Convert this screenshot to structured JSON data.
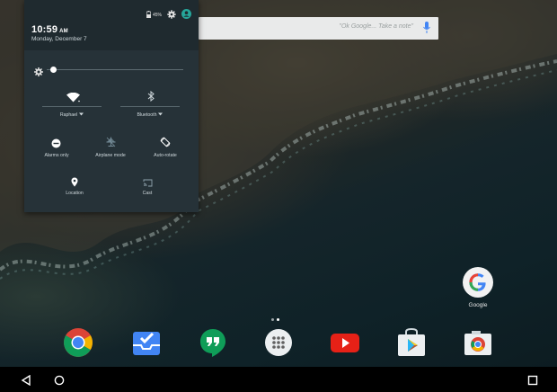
{
  "search": {
    "hint": "\"Ok Google... Take a note\""
  },
  "quick_settings": {
    "battery": "45%",
    "time": "10:59",
    "ampm": "AM",
    "date": "Monday, December 7",
    "brightness_level": 0.05,
    "tiles": {
      "wifi": "Raphael",
      "bluetooth": "Bluetooth",
      "dnd": "Alarms only",
      "airplane": "Airplane mode",
      "rotate": "Auto-rotate",
      "location": "Location",
      "cast": "Cast"
    }
  },
  "home": {
    "google_label": "Google",
    "page_count": 2,
    "current_page": 2,
    "dock": [
      "chrome-icon",
      "inbox-icon",
      "hangouts-icon",
      "app-drawer-icon",
      "youtube-icon",
      "play-store-icon",
      "camera-icon"
    ]
  },
  "colors": {
    "accent": "#26a69a",
    "panel": "#263238"
  }
}
